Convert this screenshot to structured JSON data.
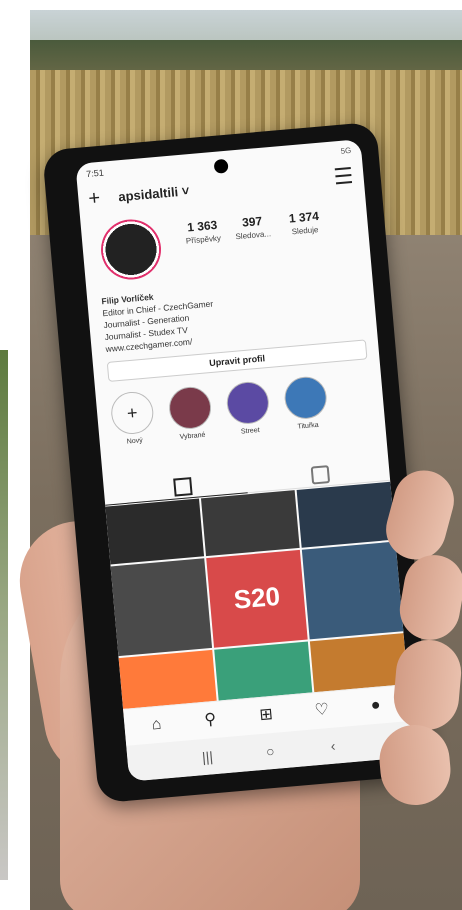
{
  "status": {
    "time": "7:51",
    "right": "5G"
  },
  "header": {
    "plus_icon": "+",
    "username": "apsidaltili ˅",
    "menu_icon": "menu-icon"
  },
  "profile": {
    "stats": [
      {
        "n": "1 363",
        "l": "Příspěvky"
      },
      {
        "n": "397",
        "l": "Sledova..."
      },
      {
        "n": "1 374",
        "l": "Sleduje"
      }
    ],
    "bio": [
      "Filip Vorlíček",
      "Editor in Chief - CzechGamer",
      "Journalist - Generation",
      "Journalist - Studex TV",
      "www.czechgamer.com/"
    ],
    "edit_label": "Upravit profil"
  },
  "highlights": [
    {
      "label": "Nový",
      "color": "#ffffff"
    },
    {
      "label": "Vybrané",
      "color": "#7a3a4a"
    },
    {
      "label": "Street",
      "color": "#5b4aa3"
    },
    {
      "label": "Tituřka",
      "color": "#3d78b7"
    }
  ],
  "tabs": {
    "grid_icon": "grid-icon",
    "tag_icon": "tag-icon"
  },
  "grid": {
    "cells": [
      {
        "color": "#2b2b2b"
      },
      {
        "color": "#3a3a3a"
      },
      {
        "color": "#2a3a4c"
      },
      {
        "color": "#4a4a4a"
      },
      {
        "color": "#d84a4a"
      },
      {
        "color": "#3a5b7a"
      },
      {
        "color": "#ff7a3a"
      },
      {
        "color": "#3aa07a"
      },
      {
        "color": "#c47b2f"
      }
    ],
    "tile_text": "S20"
  },
  "nav": {
    "home": "⌂",
    "search": "⚲",
    "add": "⊞",
    "likes": "♡",
    "profile": "●"
  },
  "system": {
    "recents": "|||",
    "home": "○",
    "back": "‹"
  }
}
